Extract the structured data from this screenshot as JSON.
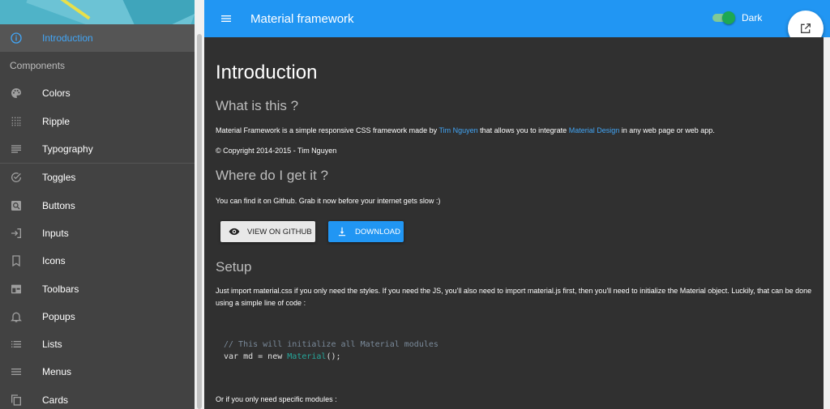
{
  "sidebar": {
    "active_item": {
      "label": "Introduction",
      "icon": "info-icon"
    },
    "subheader": "Components",
    "group1": [
      {
        "label": "Colors",
        "icon": "palette-icon"
      },
      {
        "label": "Ripple",
        "icon": "grain-icon"
      },
      {
        "label": "Typography",
        "icon": "text-lines-icon"
      }
    ],
    "group2": [
      {
        "label": "Toggles",
        "icon": "check-circle-icon"
      },
      {
        "label": "Buttons",
        "icon": "search-box-icon"
      },
      {
        "label": "Inputs",
        "icon": "input-icon"
      },
      {
        "label": "Icons",
        "icon": "bookmark-icon"
      },
      {
        "label": "Toolbars",
        "icon": "toolbar-icon"
      },
      {
        "label": "Popups",
        "icon": "bell-icon"
      },
      {
        "label": "Lists",
        "icon": "list-icon"
      },
      {
        "label": "Menus",
        "icon": "menu-icon"
      },
      {
        "label": "Cards",
        "icon": "copy-icon"
      }
    ]
  },
  "appbar": {
    "title": "Material framework",
    "toggle_label": "Dark",
    "toggle_on": true,
    "color": "#2196f3"
  },
  "main": {
    "title": "Introduction",
    "what_heading": "What is this ?",
    "what_text_1": "Material Framework is a simple responsive CSS framework made by ",
    "what_link_1": "Tim Nguyen",
    "what_text_2": " that allows you to integrate ",
    "what_link_2": "Material Design",
    "what_text_3": " in any web page or web app.",
    "copyright": "© Copyright 2014-2015 - Tim Nguyen",
    "where_heading": "Where do I get it ?",
    "where_text": "You can find it on Github. Grab it now before your internet gets slow :)",
    "btn_github": "VIEW ON GITHUB",
    "btn_download": "DOWNLOAD",
    "setup_heading": "Setup",
    "setup_text": "Just import material.css if you only need the styles. If you need the JS, you'll also need to import material.js first, then you'll need to initialize the Material object. Luckily, that can be done using a simple line of code :",
    "code_comment": "// This will initialize all Material modules",
    "code_line_a": "var md = new ",
    "code_class": "Material",
    "code_line_b": "();",
    "modules_text": "Or if you only need specific modules :"
  }
}
